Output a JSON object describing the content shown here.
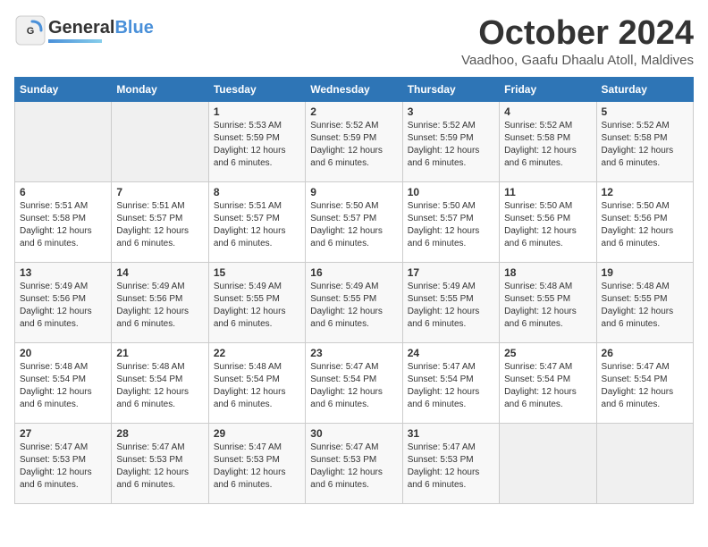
{
  "header": {
    "logo_line1": "General",
    "logo_line2": "Blue",
    "month_title": "October 2024",
    "subtitle": "Vaadhoo, Gaafu Dhaalu Atoll, Maldives"
  },
  "weekdays": [
    "Sunday",
    "Monday",
    "Tuesday",
    "Wednesday",
    "Thursday",
    "Friday",
    "Saturday"
  ],
  "weeks": [
    [
      {
        "day": "",
        "sunrise": "",
        "sunset": "",
        "daylight": ""
      },
      {
        "day": "",
        "sunrise": "",
        "sunset": "",
        "daylight": ""
      },
      {
        "day": "1",
        "sunrise": "Sunrise: 5:53 AM",
        "sunset": "Sunset: 5:59 PM",
        "daylight": "Daylight: 12 hours and 6 minutes."
      },
      {
        "day": "2",
        "sunrise": "Sunrise: 5:52 AM",
        "sunset": "Sunset: 5:59 PM",
        "daylight": "Daylight: 12 hours and 6 minutes."
      },
      {
        "day": "3",
        "sunrise": "Sunrise: 5:52 AM",
        "sunset": "Sunset: 5:59 PM",
        "daylight": "Daylight: 12 hours and 6 minutes."
      },
      {
        "day": "4",
        "sunrise": "Sunrise: 5:52 AM",
        "sunset": "Sunset: 5:58 PM",
        "daylight": "Daylight: 12 hours and 6 minutes."
      },
      {
        "day": "5",
        "sunrise": "Sunrise: 5:52 AM",
        "sunset": "Sunset: 5:58 PM",
        "daylight": "Daylight: 12 hours and 6 minutes."
      }
    ],
    [
      {
        "day": "6",
        "sunrise": "Sunrise: 5:51 AM",
        "sunset": "Sunset: 5:58 PM",
        "daylight": "Daylight: 12 hours and 6 minutes."
      },
      {
        "day": "7",
        "sunrise": "Sunrise: 5:51 AM",
        "sunset": "Sunset: 5:57 PM",
        "daylight": "Daylight: 12 hours and 6 minutes."
      },
      {
        "day": "8",
        "sunrise": "Sunrise: 5:51 AM",
        "sunset": "Sunset: 5:57 PM",
        "daylight": "Daylight: 12 hours and 6 minutes."
      },
      {
        "day": "9",
        "sunrise": "Sunrise: 5:50 AM",
        "sunset": "Sunset: 5:57 PM",
        "daylight": "Daylight: 12 hours and 6 minutes."
      },
      {
        "day": "10",
        "sunrise": "Sunrise: 5:50 AM",
        "sunset": "Sunset: 5:57 PM",
        "daylight": "Daylight: 12 hours and 6 minutes."
      },
      {
        "day": "11",
        "sunrise": "Sunrise: 5:50 AM",
        "sunset": "Sunset: 5:56 PM",
        "daylight": "Daylight: 12 hours and 6 minutes."
      },
      {
        "day": "12",
        "sunrise": "Sunrise: 5:50 AM",
        "sunset": "Sunset: 5:56 PM",
        "daylight": "Daylight: 12 hours and 6 minutes."
      }
    ],
    [
      {
        "day": "13",
        "sunrise": "Sunrise: 5:49 AM",
        "sunset": "Sunset: 5:56 PM",
        "daylight": "Daylight: 12 hours and 6 minutes."
      },
      {
        "day": "14",
        "sunrise": "Sunrise: 5:49 AM",
        "sunset": "Sunset: 5:56 PM",
        "daylight": "Daylight: 12 hours and 6 minutes."
      },
      {
        "day": "15",
        "sunrise": "Sunrise: 5:49 AM",
        "sunset": "Sunset: 5:55 PM",
        "daylight": "Daylight: 12 hours and 6 minutes."
      },
      {
        "day": "16",
        "sunrise": "Sunrise: 5:49 AM",
        "sunset": "Sunset: 5:55 PM",
        "daylight": "Daylight: 12 hours and 6 minutes."
      },
      {
        "day": "17",
        "sunrise": "Sunrise: 5:49 AM",
        "sunset": "Sunset: 5:55 PM",
        "daylight": "Daylight: 12 hours and 6 minutes."
      },
      {
        "day": "18",
        "sunrise": "Sunrise: 5:48 AM",
        "sunset": "Sunset: 5:55 PM",
        "daylight": "Daylight: 12 hours and 6 minutes."
      },
      {
        "day": "19",
        "sunrise": "Sunrise: 5:48 AM",
        "sunset": "Sunset: 5:55 PM",
        "daylight": "Daylight: 12 hours and 6 minutes."
      }
    ],
    [
      {
        "day": "20",
        "sunrise": "Sunrise: 5:48 AM",
        "sunset": "Sunset: 5:54 PM",
        "daylight": "Daylight: 12 hours and 6 minutes."
      },
      {
        "day": "21",
        "sunrise": "Sunrise: 5:48 AM",
        "sunset": "Sunset: 5:54 PM",
        "daylight": "Daylight: 12 hours and 6 minutes."
      },
      {
        "day": "22",
        "sunrise": "Sunrise: 5:48 AM",
        "sunset": "Sunset: 5:54 PM",
        "daylight": "Daylight: 12 hours and 6 minutes."
      },
      {
        "day": "23",
        "sunrise": "Sunrise: 5:47 AM",
        "sunset": "Sunset: 5:54 PM",
        "daylight": "Daylight: 12 hours and 6 minutes."
      },
      {
        "day": "24",
        "sunrise": "Sunrise: 5:47 AM",
        "sunset": "Sunset: 5:54 PM",
        "daylight": "Daylight: 12 hours and 6 minutes."
      },
      {
        "day": "25",
        "sunrise": "Sunrise: 5:47 AM",
        "sunset": "Sunset: 5:54 PM",
        "daylight": "Daylight: 12 hours and 6 minutes."
      },
      {
        "day": "26",
        "sunrise": "Sunrise: 5:47 AM",
        "sunset": "Sunset: 5:54 PM",
        "daylight": "Daylight: 12 hours and 6 minutes."
      }
    ],
    [
      {
        "day": "27",
        "sunrise": "Sunrise: 5:47 AM",
        "sunset": "Sunset: 5:53 PM",
        "daylight": "Daylight: 12 hours and 6 minutes."
      },
      {
        "day": "28",
        "sunrise": "Sunrise: 5:47 AM",
        "sunset": "Sunset: 5:53 PM",
        "daylight": "Daylight: 12 hours and 6 minutes."
      },
      {
        "day": "29",
        "sunrise": "Sunrise: 5:47 AM",
        "sunset": "Sunset: 5:53 PM",
        "daylight": "Daylight: 12 hours and 6 minutes."
      },
      {
        "day": "30",
        "sunrise": "Sunrise: 5:47 AM",
        "sunset": "Sunset: 5:53 PM",
        "daylight": "Daylight: 12 hours and 6 minutes."
      },
      {
        "day": "31",
        "sunrise": "Sunrise: 5:47 AM",
        "sunset": "Sunset: 5:53 PM",
        "daylight": "Daylight: 12 hours and 6 minutes."
      },
      {
        "day": "",
        "sunrise": "",
        "sunset": "",
        "daylight": ""
      },
      {
        "day": "",
        "sunrise": "",
        "sunset": "",
        "daylight": ""
      }
    ]
  ]
}
